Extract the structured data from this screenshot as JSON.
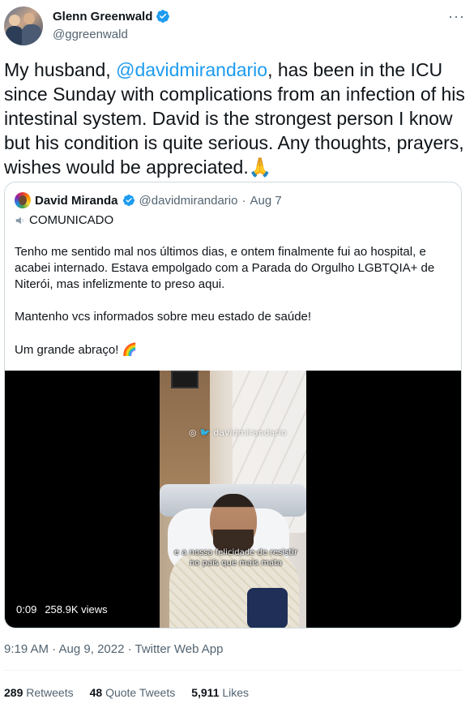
{
  "tweet": {
    "author": {
      "name": "Glenn Greenwald",
      "handle": "@ggreenwald",
      "verified": true
    },
    "more_icon": "more-horizontal-icon",
    "text_before_mention": "My husband, ",
    "mention": "@davidmirandario",
    "text_after_mention": ", has been in the ICU since Sunday with complications from an infection of his intestinal system. David is the strongest person I know but his condition is quite serious. Any thoughts, prayers, wishes would be appreciated.",
    "text_emoji": "🙏",
    "timestamp": "9:19 AM · Aug 9, 2022 · Twitter Web App",
    "stats": {
      "retweets_count": "289",
      "retweets_label": "Retweets",
      "quotes_count": "48",
      "quotes_label": "Quote Tweets",
      "likes_count": "5,911",
      "likes_label": "Likes"
    }
  },
  "quoted_tweet": {
    "author_name": "David Miranda",
    "handle": "@davidmirandario",
    "separator": "·",
    "date": "Aug 7",
    "speaker_icon": "speaker-icon",
    "subtitle": "COMUNICADO",
    "paragraphs": [
      "Tenho me sentido mal nos últimos dias, e ontem finalmente fui ao hospital, e acabei internado. Estava empolgado com a Parada do Orgulho LGBTQIA+ de Niterói, mas infelizmente to preso aqui.",
      "Mantenho vcs informados sobre meu estado de saúde!"
    ],
    "closing": "Um grande abraço!",
    "closing_emoji": "🌈",
    "video": {
      "watermark": "◎ 🐦 davidmirandario",
      "caption": "e a nossa felicidade de resistir no país que mais mata",
      "duration": "0:09",
      "views": "258.9K views"
    }
  },
  "colors": {
    "accent": "#1d9bf0",
    "text": "#0f1419",
    "secondary": "#536471",
    "border": "#cfd9de"
  }
}
